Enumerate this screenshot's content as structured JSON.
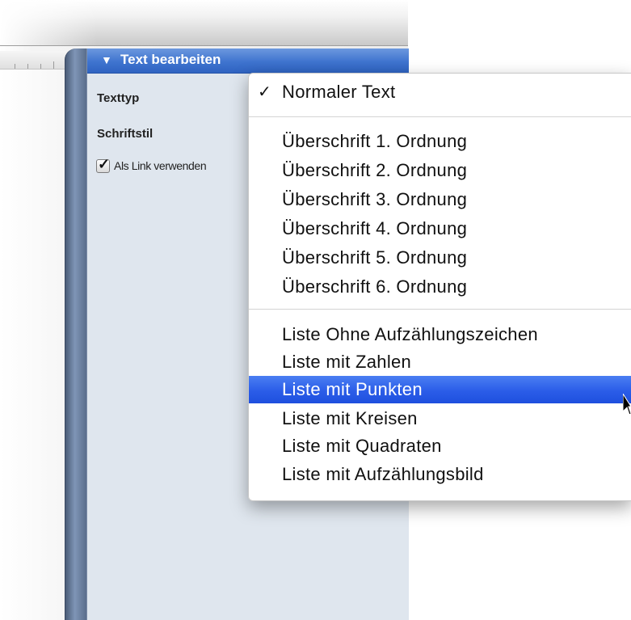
{
  "panel": {
    "title": "Text bearbeiten",
    "rows": {
      "texttyp": "Texttyp",
      "schriftstil": "Schriftstil",
      "link_label": "Als Link verwenden"
    }
  },
  "menu": {
    "checked_item": "Normaler Text",
    "checkmark": "✓",
    "headings": [
      "Überschrift 1. Ordnung",
      "Überschrift 2. Ordnung",
      "Überschrift 3. Ordnung",
      "Überschrift 4. Ordnung",
      "Überschrift 5. Ordnung",
      "Überschrift 6. Ordnung"
    ],
    "lists": [
      "Liste Ohne Aufzählungszeichen",
      "Liste mit Zahlen",
      "Liste mit Punkten",
      "Liste mit Kreisen",
      "Liste mit Quadraten",
      "Liste mit Aufzählungsbild"
    ],
    "highlighted_item": "Liste mit Punkten"
  },
  "icons": {
    "disclosure": "disclosure-triangle-icon",
    "checkbox": "checkbox-checked-icon",
    "cursor": "mouse-pointer-icon"
  },
  "colors": {
    "header_blue": "#3f74cf",
    "selection_blue": "#2b5de8",
    "panel_bg": "#dfe6ee"
  }
}
